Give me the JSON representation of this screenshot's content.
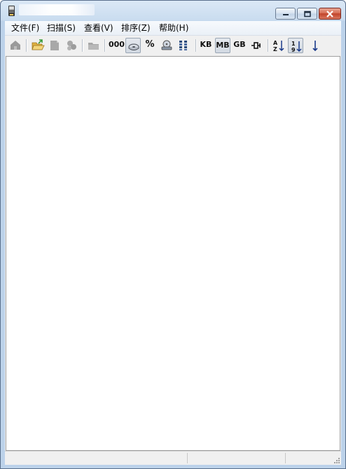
{
  "window": {
    "title": "",
    "caption_buttons": [
      "minimize",
      "maximize",
      "close"
    ]
  },
  "menu": {
    "items": [
      {
        "label": "文件(F)"
      },
      {
        "label": "扫描(S)"
      },
      {
        "label": "查看(V)"
      },
      {
        "label": "排序(Z)"
      },
      {
        "label": "帮助(H)"
      }
    ]
  },
  "toolbar": {
    "buttons": [
      {
        "id": "up-folder",
        "icon": "folder-up-icon",
        "enabled": false
      },
      {
        "id": "open",
        "icon": "open-folder-icon",
        "enabled": true
      },
      {
        "id": "page",
        "icon": "page-icon",
        "enabled": false
      },
      {
        "id": "refresh",
        "icon": "refresh-icon",
        "enabled": false
      },
      {
        "id": "folder",
        "icon": "folder-icon",
        "enabled": false
      },
      {
        "id": "count",
        "text": "000",
        "enabled": true,
        "pressed": false
      },
      {
        "id": "size",
        "icon": "disk-icon",
        "enabled": true,
        "pressed": true
      },
      {
        "id": "percent",
        "text": "%",
        "enabled": true,
        "pressed": false
      },
      {
        "id": "drive",
        "icon": "drive-icon",
        "enabled": true,
        "pressed": false
      },
      {
        "id": "columns",
        "icon": "columns-icon",
        "enabled": true,
        "pressed": false
      },
      {
        "id": "kb",
        "text": "KB",
        "enabled": true,
        "pressed": false
      },
      {
        "id": "mb",
        "text": "MB",
        "enabled": true,
        "pressed": true
      },
      {
        "id": "gb",
        "text": "GB",
        "enabled": true,
        "pressed": false
      },
      {
        "id": "auto",
        "icon": "auto-unit-icon",
        "enabled": true,
        "pressed": false
      },
      {
        "id": "sort-name",
        "icon": "sort-az-icon",
        "enabled": true,
        "pressed": false
      },
      {
        "id": "sort-size",
        "icon": "sort-19-icon",
        "enabled": true,
        "pressed": true
      },
      {
        "id": "sort-dir",
        "icon": "arrow-down-icon",
        "enabled": true,
        "pressed": false
      }
    ]
  },
  "status": {
    "panes": [
      "",
      "",
      ""
    ]
  },
  "colors": {
    "frame": "#bcd2ea",
    "close_button": "#c1432a",
    "content_bg": "#ffffff"
  }
}
